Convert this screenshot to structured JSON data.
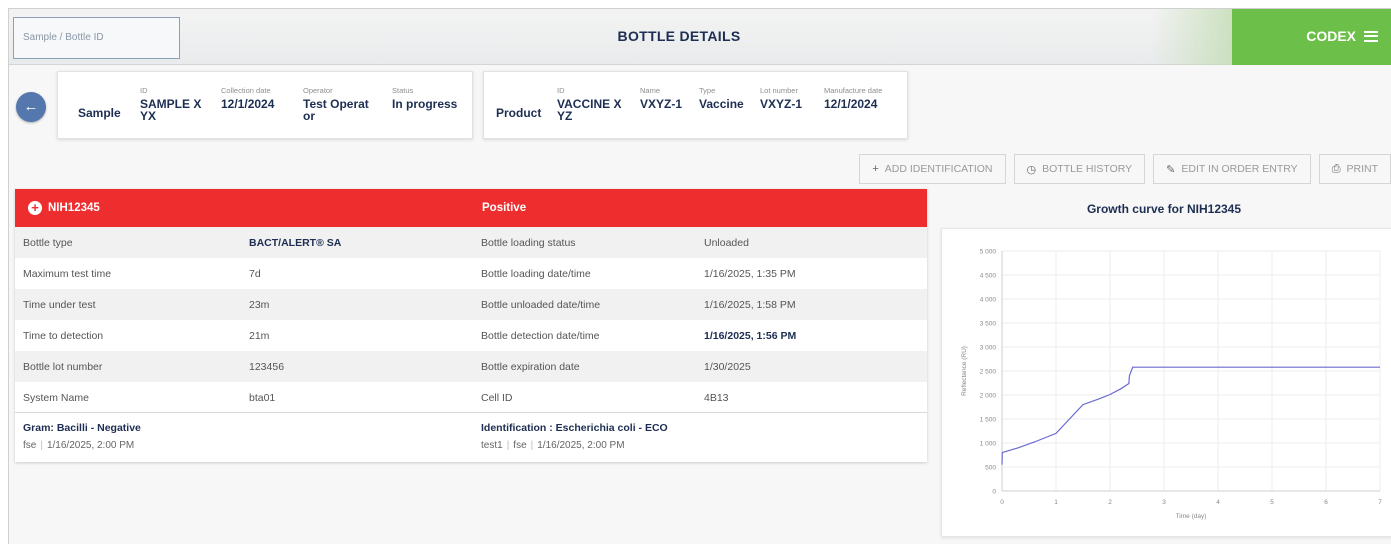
{
  "header": {
    "search_placeholder": "Sample / Bottle ID",
    "title": "BOTTLE DETAILS",
    "brand": "CODEX",
    "brand_color": "#6cbf48"
  },
  "sample": {
    "title": "Sample",
    "fields": [
      {
        "label": "ID",
        "value_line1": "SAMPLE X",
        "value_line2": "YX"
      },
      {
        "label": "Collection date",
        "value_line1": "12/1/2024",
        "value_line2": ""
      },
      {
        "label": "Operator",
        "value_line1": "Test Operat",
        "value_line2": "or"
      },
      {
        "label": "Status",
        "value_line1": "In progress",
        "value_line2": ""
      }
    ]
  },
  "product": {
    "title": "Product",
    "fields": [
      {
        "label": "ID",
        "value_line1": "VACCINE X",
        "value_line2": "YZ"
      },
      {
        "label": "Name",
        "value_line1": "VXYZ-1",
        "value_line2": ""
      },
      {
        "label": "Type",
        "value_line1": "Vaccine",
        "value_line2": ""
      },
      {
        "label": "Lot number",
        "value_line1": "VXYZ-1",
        "value_line2": ""
      },
      {
        "label": "Manufacture date",
        "value_line1": "12/1/2024",
        "value_line2": ""
      }
    ]
  },
  "actions": {
    "add_identification": "ADD IDENTIFICATION",
    "bottle_history": "BOTTLE HISTORY",
    "edit_order_entry": "EDIT IN ORDER ENTRY",
    "print": "PRINT"
  },
  "detail": {
    "bottle_id": "NIH12345",
    "result": "Positive",
    "header_color": "#ee2e2e",
    "rows": [
      {
        "l1": "Bottle type",
        "v1": "BACT/ALERT® SA",
        "l2": "Bottle loading status",
        "v2": "Unloaded"
      },
      {
        "l1": "Maximum test time",
        "v1": "7d",
        "l2": "Bottle loading date/time",
        "v2": "1/16/2025, 1:35 PM"
      },
      {
        "l1": "Time under test",
        "v1": "23m",
        "l2": "Bottle unloaded date/time",
        "v2": "1/16/2025, 1:58 PM"
      },
      {
        "l1": "Time to detection",
        "v1": "21m",
        "l2": "Bottle detection date/time",
        "v2": "1/16/2025, 1:56 PM"
      },
      {
        "l1": "Bottle lot number",
        "v1": "123456",
        "l2": "Bottle expiration date",
        "v2": "1/30/2025"
      },
      {
        "l1": "System Name",
        "v1": "bta01",
        "l2": "Cell ID",
        "v2": "4B13"
      }
    ],
    "gram": {
      "title": "Gram: Bacilli - Negative",
      "user": "fse",
      "date": "1/16/2025, 2:00 PM"
    },
    "identification": {
      "title": "Identification : Escherichia coli - ECO",
      "test": "test1",
      "user": "fse",
      "date": "1/16/2025, 2:00 PM"
    }
  },
  "chart_title": "Growth curve for NIH12345",
  "chart_data": {
    "type": "line",
    "title": "Growth curve for NIH12345",
    "xlabel": "Time (day)",
    "ylabel": "Reflectance (RU)",
    "xlim": [
      0,
      7
    ],
    "ylim": [
      0,
      5000
    ],
    "x_ticks": [
      0,
      1,
      2,
      3,
      4,
      5,
      6,
      7
    ],
    "y_ticks": [
      0,
      500,
      1000,
      1500,
      2000,
      2500,
      3000,
      3500,
      4000,
      4500,
      5000
    ],
    "y_tick_labels": [
      "0",
      "500",
      "1 000",
      "1 500",
      "2 000",
      "2 500",
      "3 000",
      "3 500",
      "4 000",
      "4 500",
      "5 000"
    ],
    "grid": true,
    "line_color": "#6a6ad0",
    "series": [
      {
        "x": [
          0,
          0.005,
          0.3,
          0.6,
          1.0,
          1.5,
          1.8,
          2.0,
          2.2,
          2.35,
          2.36,
          2.42,
          3.0,
          4.0,
          5.0,
          6.0,
          7.0
        ],
        "y": [
          550,
          800,
          900,
          1020,
          1200,
          1800,
          1920,
          2010,
          2130,
          2240,
          2400,
          2580,
          2580,
          2580,
          2580,
          2580,
          2580
        ]
      }
    ]
  }
}
